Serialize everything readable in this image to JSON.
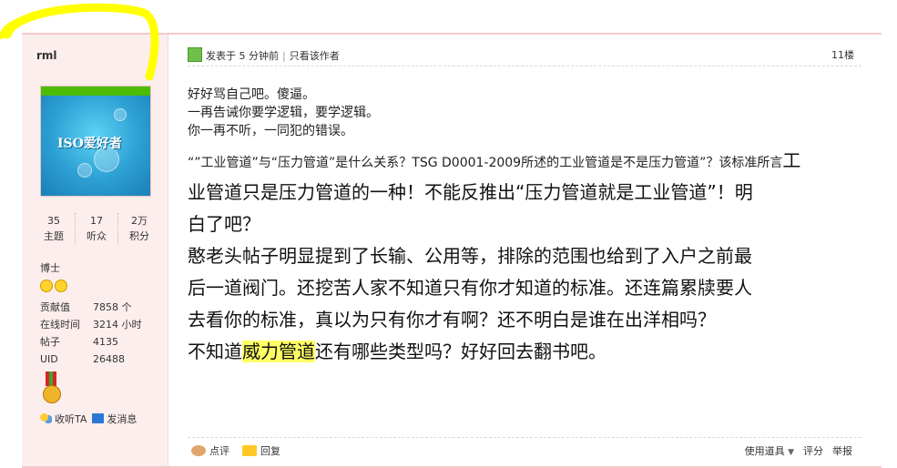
{
  "sidebar": {
    "username": "rml",
    "avatar_text": "ISO爱好者",
    "stats": [
      {
        "value": "35",
        "label": "主题"
      },
      {
        "value": "17",
        "label": "听众"
      },
      {
        "value": "2万",
        "label": "积分"
      }
    ],
    "rank": "博士",
    "info": [
      {
        "key": "贡献值",
        "value": "7858 个"
      },
      {
        "key": "在线时间",
        "value": "3214 小时"
      },
      {
        "key": "帖子",
        "value": "4135"
      },
      {
        "key": "UID",
        "value": "26488"
      }
    ],
    "listen_label": "收听TA",
    "message_label": "发消息"
  },
  "header": {
    "posted": "发表于 5 分钟前",
    "sep": "|",
    "only_author": "只看该作者",
    "floor": "11楼"
  },
  "post": {
    "line1": "好好骂自己吧。傻逼。",
    "line2": "一再告诫你要学逻辑，要学逻辑。",
    "line3": "你一再不听，一同犯的错误。",
    "mix_small": "“”工业管道”与“压力管道”是什么关系？TSG D0001-2009所述的工业管道是不是压力管道”？该标准所言",
    "mix_big": "工",
    "big1": "业管道只是压力管道的一种！不能反推出“压力管道就是工业管道”！明",
    "big2": "白了吧？",
    "big3": "憨老头帖子明显提到了长输、公用等，排除的范围也给到了入户之前最",
    "big4": "后一道阀门。还挖苦人家不知道只有你才知道的标准。还连篇累牍要人",
    "big5": "去看你的标准，真以为只有你才有啊？还不明白是谁在出洋相吗？",
    "big6_pre": "不知道",
    "big6_hl": "威力管道",
    "big6_post": "还有哪些类型吗？好好回去翻书吧。"
  },
  "footer": {
    "comment": "点评",
    "reply": "回复",
    "tools": "使用道具",
    "rate": "评分",
    "report": "举报"
  },
  "colors": {
    "sidebar_bg": "#fdeeee",
    "highlight": "#ffff66",
    "scribble": "#ffff00"
  }
}
